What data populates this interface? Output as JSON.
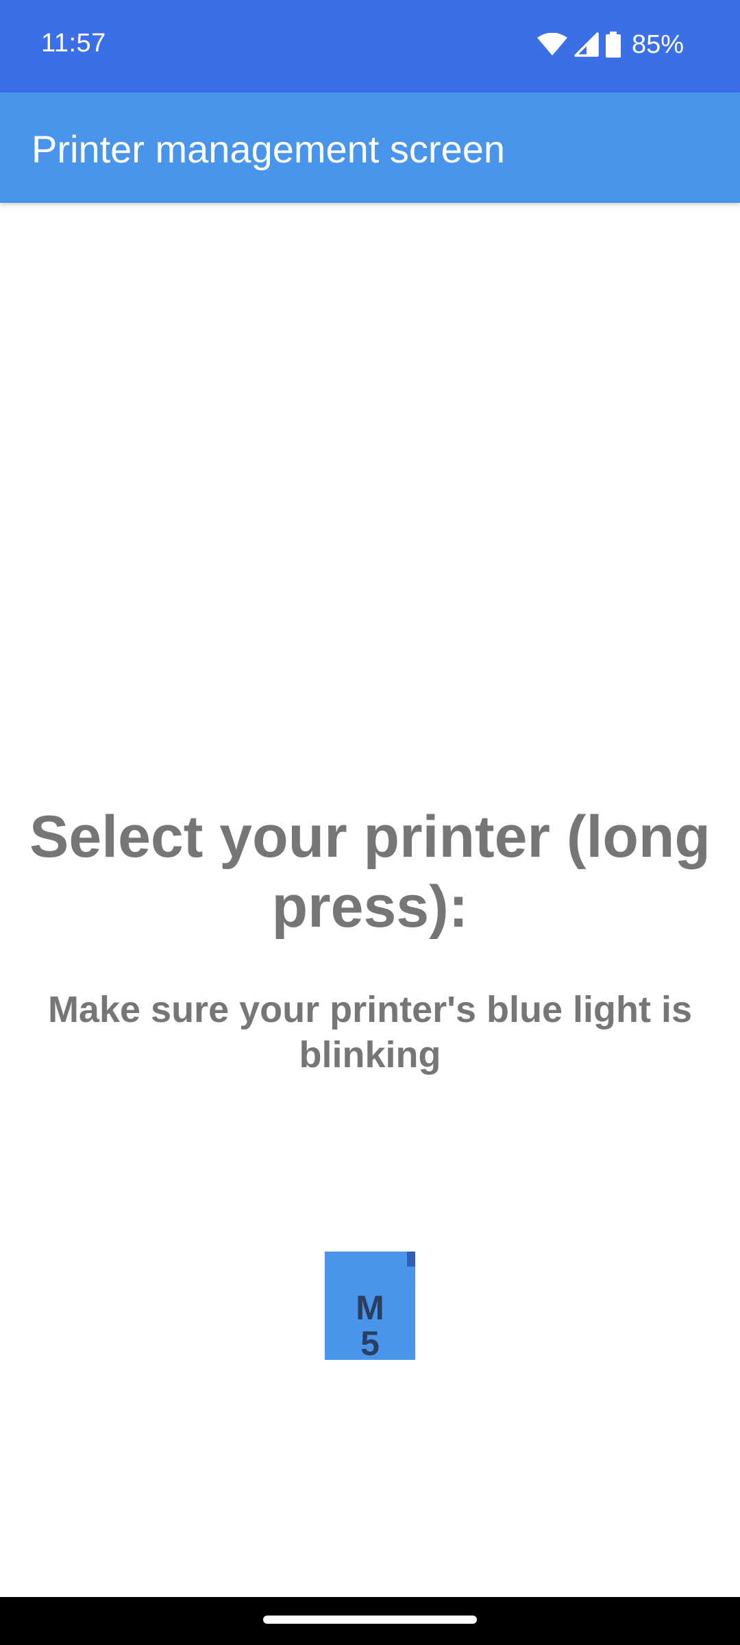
{
  "status_bar": {
    "time": "11:57",
    "battery_percent": "85%",
    "icons": [
      "wifi-icon",
      "cellular-signal-icon",
      "battery-icon"
    ]
  },
  "app_bar": {
    "title": "Printer management screen"
  },
  "main": {
    "heading": "Select your printer (long press):",
    "instruction": "Make sure your printer's blue light is blinking",
    "printers": [
      {
        "label": "M5"
      }
    ]
  },
  "colors": {
    "status_bar": "#3a6fe8",
    "app_bar": "#4a95ec",
    "text_gray": "#767676",
    "printer_tile": "#4a95ec"
  }
}
